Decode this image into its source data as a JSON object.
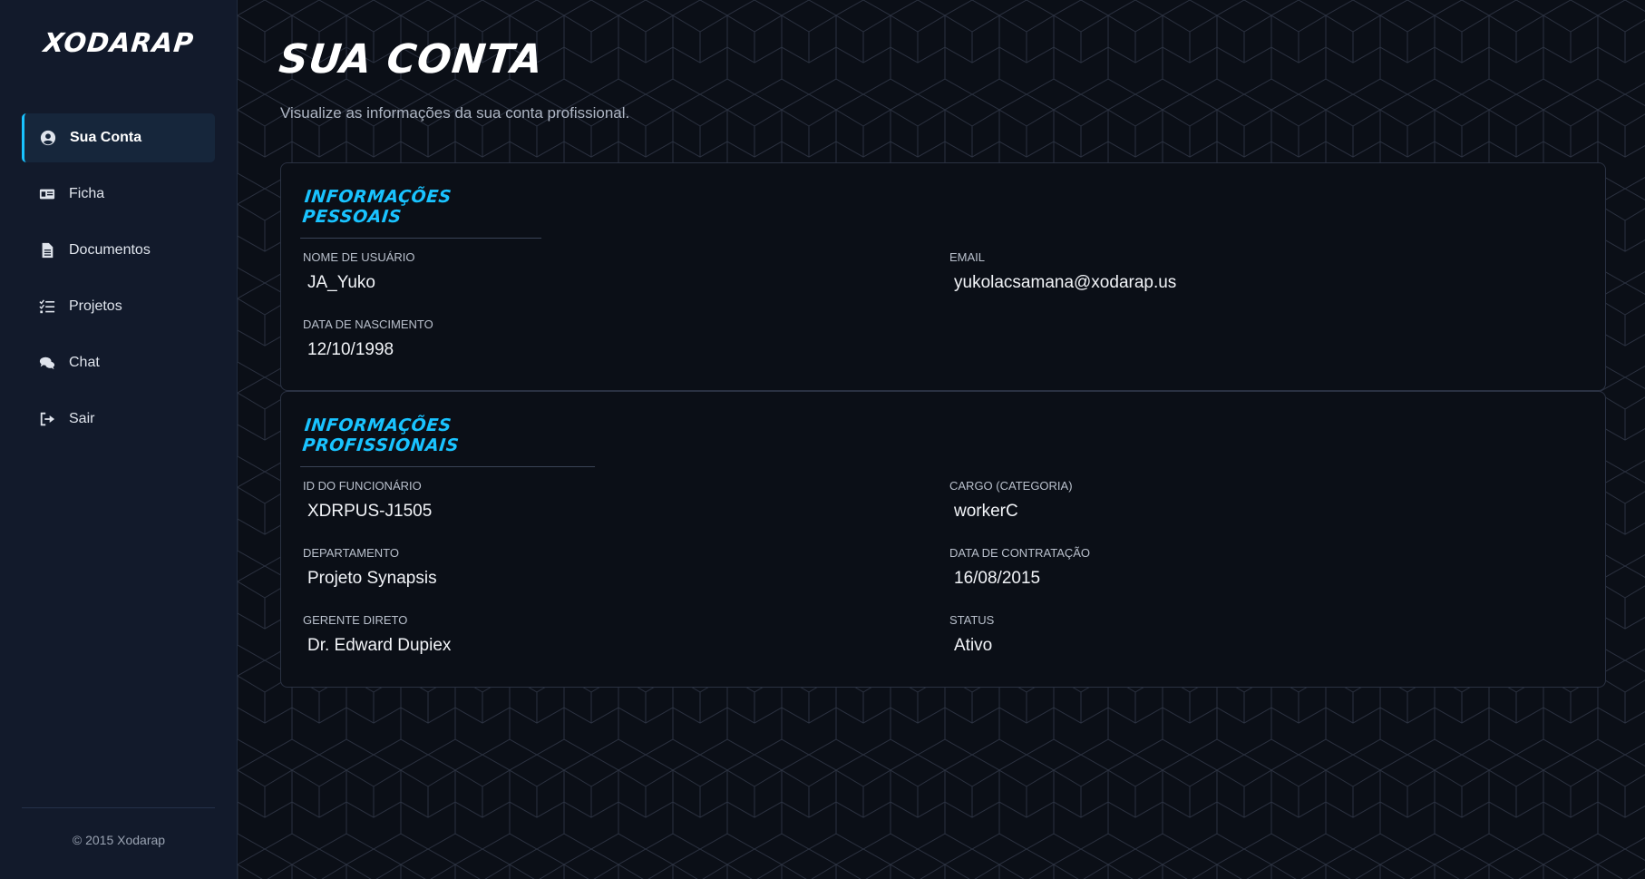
{
  "sidebar": {
    "logo": "XODARAP",
    "items": [
      {
        "label": "Sua Conta",
        "icon": "user-circle-icon",
        "active": true
      },
      {
        "label": "Ficha",
        "icon": "id-card-icon",
        "active": false
      },
      {
        "label": "Documentos",
        "icon": "document-icon",
        "active": false
      },
      {
        "label": "Projetos",
        "icon": "task-list-icon",
        "active": false
      },
      {
        "label": "Chat",
        "icon": "chat-bubbles-icon",
        "active": false
      },
      {
        "label": "Sair",
        "icon": "logout-icon",
        "active": false
      }
    ],
    "copyright": "© 2015 Xodarap"
  },
  "header": {
    "title": "SUA CONTA",
    "subtitle": "Visualize as informações da sua conta profissional."
  },
  "personal": {
    "title": "INFORMAÇÕES PESSOAIS",
    "username_label": "NOME DE USUÁRIO",
    "username": "JA_Yuko",
    "email_label": "EMAIL",
    "email": "yukolacsamana@xodarap.us",
    "birth_label": "DATA DE NASCIMENTO",
    "birth": "12/10/1998"
  },
  "professional": {
    "title": "INFORMAÇÕES PROFISSIONAIS",
    "employee_id_label": "ID DO FUNCIONÁRIO",
    "employee_id": "XDRPUS-J1505",
    "role_label": "CARGO (CATEGORIA)",
    "role": "workerC",
    "department_label": "DEPARTAMENTO",
    "department": "Projeto Synapsis",
    "hire_date_label": "DATA DE CONTRATAÇÃO",
    "hire_date": "16/08/2015",
    "manager_label": "GERENTE DIRETO",
    "manager": "Dr. Edward Dupiex",
    "status_label": "STATUS",
    "status": "Ativo"
  },
  "colors": {
    "accent": "#19c3ff",
    "sidebar_bg": "#121a2b",
    "main_bg": "#0b0f17"
  }
}
